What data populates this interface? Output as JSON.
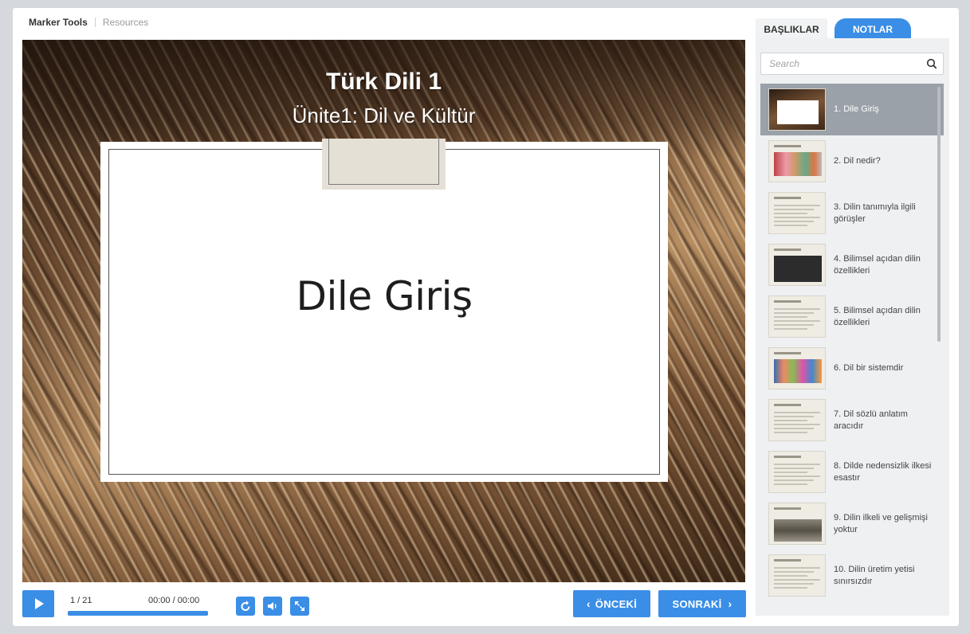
{
  "toplinks": {
    "marker_tools": "Marker Tools",
    "resources": "Resources"
  },
  "slide": {
    "title": "Türk Dili 1",
    "subtitle": "Ünite1: Dil ve Kültür",
    "heading": "Dile Giriş"
  },
  "player": {
    "counter": "1 / 21",
    "time": "00:00 / 00:00",
    "progress": 1.0,
    "prev_label": "ÖNCEKİ",
    "next_label": "SONRAKİ"
  },
  "sidebar": {
    "tab_headings": "BAŞLIKLAR",
    "tab_notes": "NOTLAR",
    "search_placeholder": "Search",
    "items": [
      {
        "label": "1. Dile Giriş",
        "thumb": "dark"
      },
      {
        "label": "2. Dil nedir?",
        "thumb": "photo"
      },
      {
        "label": "3. Dilin tanımıyla ilgili görüşler",
        "thumb": "text"
      },
      {
        "label": "4. Bilimsel açıdan dilin özellikleri",
        "thumb": "board"
      },
      {
        "label": "5. Bilimsel açıdan dilin özellikleri",
        "thumb": "text"
      },
      {
        "label": "6. Dil bir sistemdir",
        "thumb": "kids"
      },
      {
        "label": "7. Dil sözlü anlatım aracıdır",
        "thumb": "text"
      },
      {
        "label": "8. Dilde nedensizlik ilkesi esastır",
        "thumb": "text"
      },
      {
        "label": "9. Dilin ilkeli ve gelişmişi yoktur",
        "thumb": "rubble"
      },
      {
        "label": "10. Dilin üretim yetisi sınırsızdır",
        "thumb": "text"
      }
    ]
  },
  "colors": {
    "accent": "#3a8ee6",
    "active_item": "#9aa1a8"
  }
}
